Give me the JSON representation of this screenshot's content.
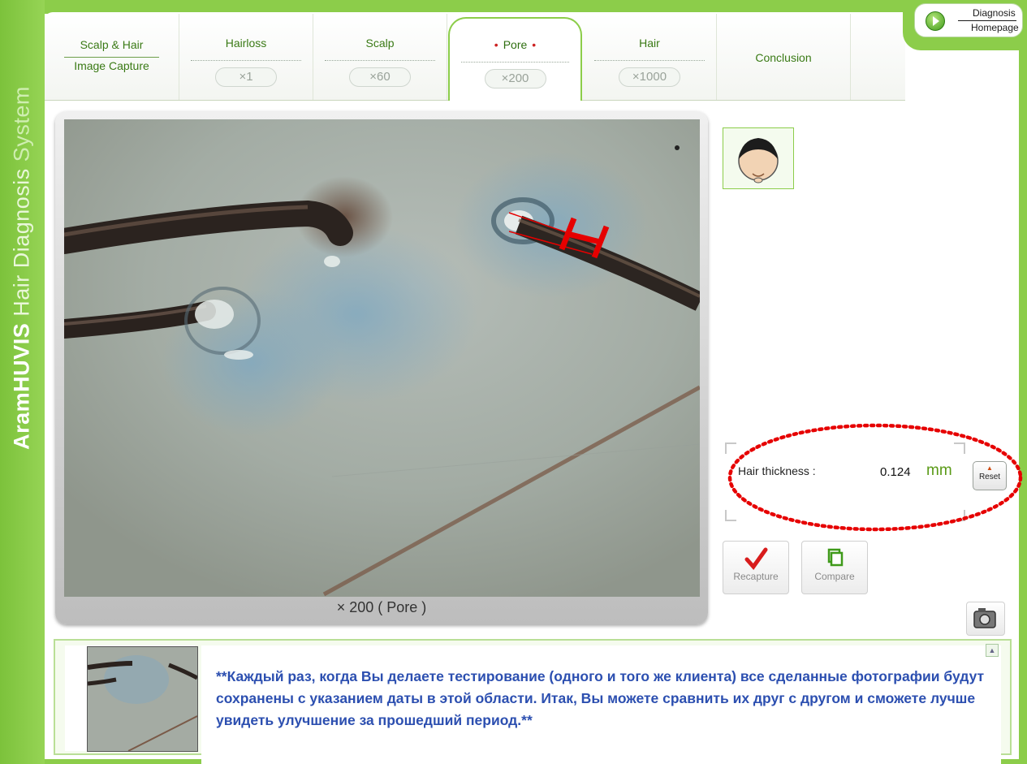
{
  "brand": {
    "strong": "AramHUVIS",
    "rest": "Hair Diagnosis",
    "tail": "System"
  },
  "tabs": [
    {
      "label": "Scalp & Hair",
      "label2": "Image Capture"
    },
    {
      "label": "Hairloss",
      "zoom": "×1"
    },
    {
      "label": "Scalp",
      "zoom": "×60"
    },
    {
      "label": "Pore",
      "zoom": "×200",
      "active": true
    },
    {
      "label": "Hair",
      "zoom": "×1000"
    },
    {
      "label": "Conclusion"
    }
  ],
  "home_button": {
    "line1": "Diagnosis",
    "line2": "Homepage"
  },
  "viewer": {
    "caption": "× 200 ( Pore )"
  },
  "measurement": {
    "label": "Hair thickness :",
    "value": "0.124",
    "unit": "mm",
    "reset": "Reset"
  },
  "actions": {
    "recapture": "Recapture",
    "compare": "Compare"
  },
  "note": "**Каждый раз, когда Вы делаете тестирование (одного и того же клиента) все сделанные фотографии будут сохранены с указанием даты в этой области. Итак, Вы можете сравнить их друг с  другом и  сможете лучше увидеть улучшение за прошедший период.**",
  "colors": {
    "brand_green": "#8ccd4a",
    "tab_text": "#3a7a15",
    "note_text": "#2c4fb0",
    "highlight": "#e60000"
  }
}
